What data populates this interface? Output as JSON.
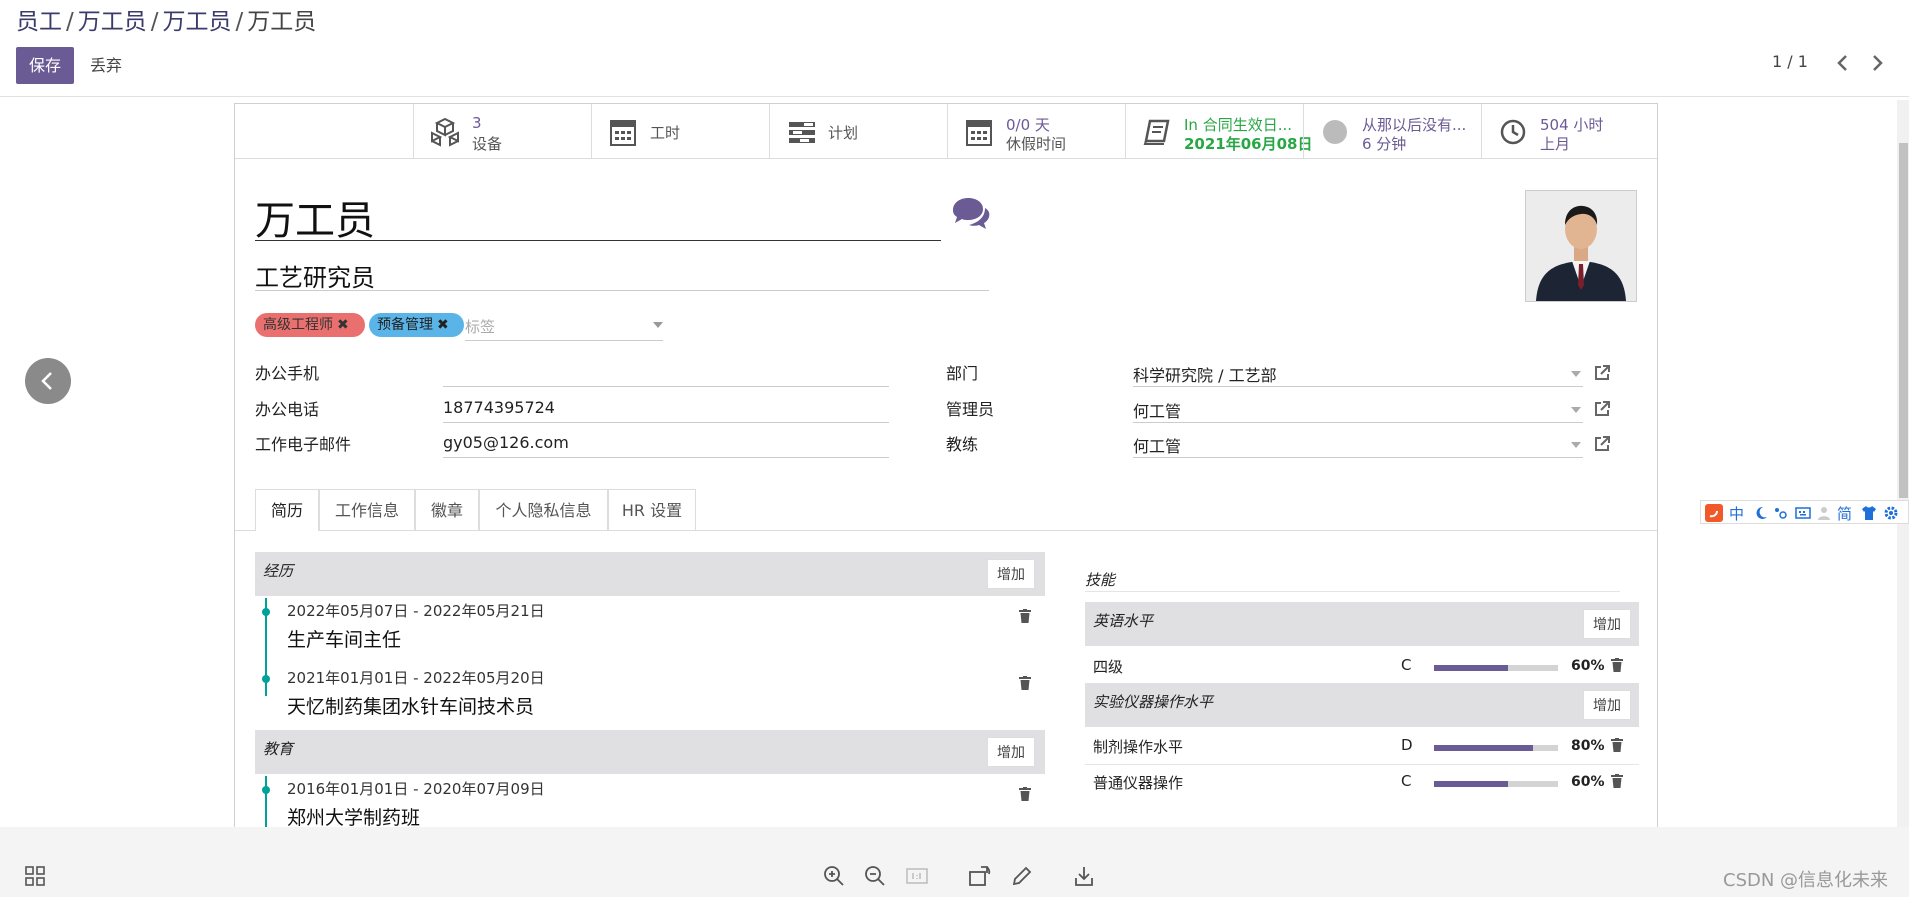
{
  "breadcrumb": {
    "items": [
      "员工",
      "万工员",
      "万工员"
    ],
    "current": "万工员",
    "separator": "/"
  },
  "toolbar": {
    "save_label": "保存",
    "discard_label": "丢弃"
  },
  "pager": {
    "value": "1 / 1"
  },
  "smart_buttons": [
    {
      "icon": "cubes-icon",
      "line1": "3",
      "line2": "设备"
    },
    {
      "icon": "calendar-icon",
      "line1": "工时"
    },
    {
      "icon": "tasks-icon",
      "line1": "计划"
    },
    {
      "icon": "calendar-icon",
      "line1": "0/0 天",
      "line2": "休假时间"
    },
    {
      "icon": "book-icon",
      "line1": "In 合同生效日...",
      "line2": "2021年06月08日"
    },
    {
      "icon": "presence-circle-icon",
      "line1": "从那以后没有...",
      "line2": "6 分钟"
    },
    {
      "icon": "clock-icon",
      "line1": "504 小时",
      "line2": "上月"
    }
  ],
  "employee": {
    "name": "万工员",
    "job_title": "工艺研究员",
    "tags": [
      {
        "label": "高级工程师",
        "color": "#ea7070"
      },
      {
        "label": "预备管理",
        "color": "#5ab4e8"
      }
    ],
    "tag_placeholder": "标签"
  },
  "fields_left": [
    {
      "label": "办公手机",
      "value": ""
    },
    {
      "label": "办公电话",
      "value": "18774395724"
    },
    {
      "label": "工作电子邮件",
      "value": "gy05@126.com"
    }
  ],
  "fields_right": [
    {
      "label": "部门",
      "value": "科学研究院 / 工艺部"
    },
    {
      "label": "管理员",
      "value": "何工管"
    },
    {
      "label": "教练",
      "value": "何工管"
    }
  ],
  "tabs": [
    "简历",
    "工作信息",
    "徽章",
    "个人隐私信息",
    "HR 设置"
  ],
  "resume": {
    "add_label": "增加",
    "sections": [
      {
        "title": "经历",
        "lines": [
          {
            "date": "2022年05月07日 - 2022年05月21日",
            "title": "生产车间主任"
          },
          {
            "date": "2021年01月01日 - 2022年05月20日",
            "title": "天忆制药集团水针车间技术员"
          }
        ]
      },
      {
        "title": "教育",
        "lines": [
          {
            "date": "2016年01月01日 - 2020年07月09日",
            "title": "郑州大学制药班"
          }
        ]
      }
    ]
  },
  "skills": {
    "title": "技能",
    "add_label": "增加",
    "groups": [
      {
        "title": "英语水平",
        "items": [
          {
            "name": "四级",
            "level": "C",
            "progress": 60,
            "pct_label": "60%"
          }
        ]
      },
      {
        "title": "实验仪器操作水平",
        "items": [
          {
            "name": "制剂操作水平",
            "level": "D",
            "progress": 80,
            "pct_label": "80%"
          },
          {
            "name": "普通仪器操作",
            "level": "C",
            "progress": 60,
            "pct_label": "60%"
          }
        ]
      }
    ]
  },
  "ime": {
    "items": [
      "中",
      "简"
    ]
  },
  "watermark": "CSDN @信息化未来",
  "colors": {
    "primary": "#6b5b95",
    "teal": "#00a09d",
    "green": "#28a745"
  }
}
